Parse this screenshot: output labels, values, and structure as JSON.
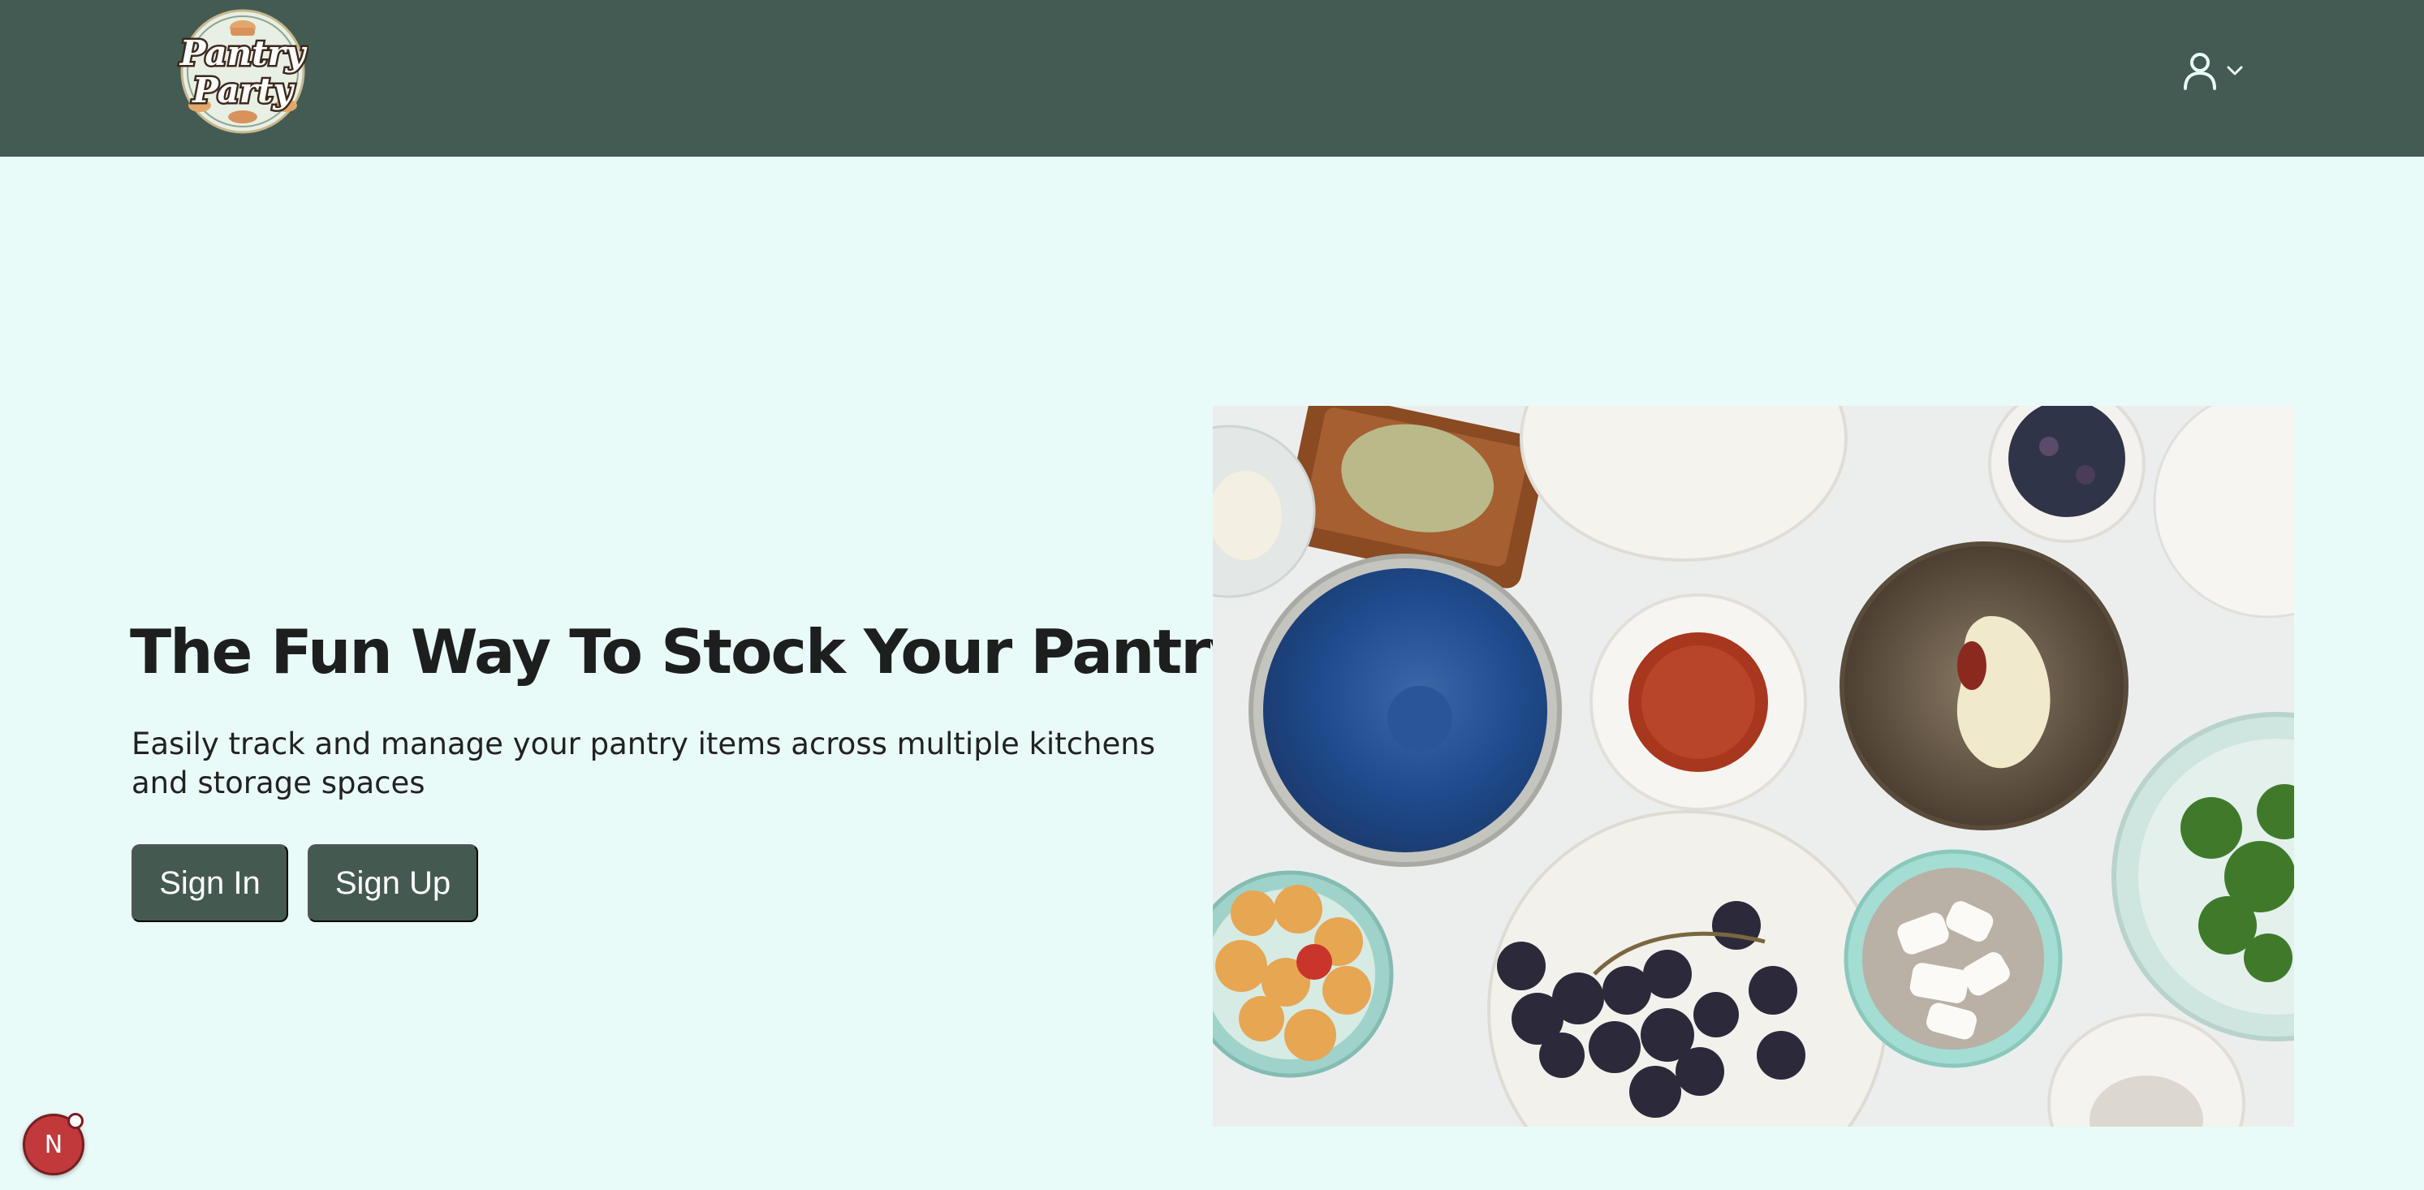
{
  "header": {
    "logo_text_line1": "Pantry",
    "logo_text_line2": "Party",
    "user_icon": "user-icon",
    "dropdown_icon": "chevron-down-icon"
  },
  "hero": {
    "title": "The Fun Way To Stock Your Pantry",
    "subtitle": "Easily track and manage your pantry items across multiple kitchens and storage spaces",
    "sign_in_label": "Sign In",
    "sign_up_label": "Sign Up"
  },
  "dev_badge": {
    "label": "N"
  },
  "colors": {
    "nav_bg": "#435b52",
    "page_bg": "#e9fbf8",
    "button_bg": "#445a51",
    "title_color": "#1d1f1f"
  }
}
